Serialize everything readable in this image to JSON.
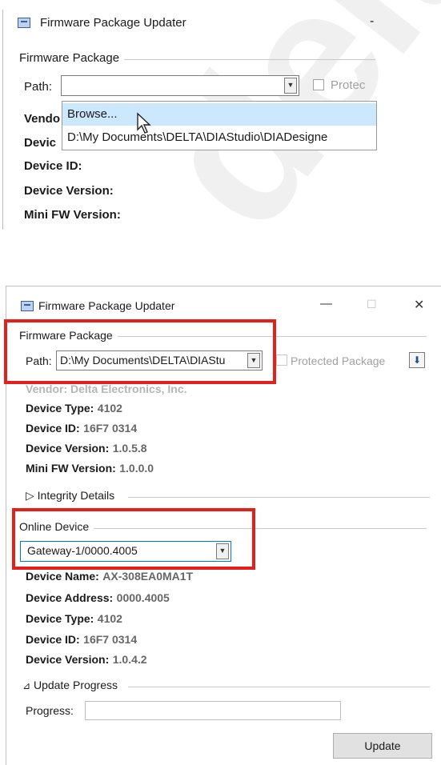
{
  "top_dialog": {
    "title": "Firmware Package Updater",
    "minimize_glyph": "-",
    "group_label": "Firmware Package",
    "path_label": "Path:",
    "path_value": "",
    "protected_label": "Protec",
    "dropdown_items": [
      "Browse...",
      "D:\\My Documents\\DELTA\\DIAStudio\\DIADesigne"
    ],
    "fields_partial": [
      "Vendo",
      "Devic"
    ],
    "fields": [
      "Device ID:",
      "Device Version:",
      "Mini FW Version:"
    ]
  },
  "bottom_dialog": {
    "title": "Firmware Package Updater",
    "window_controls": {
      "minimize": "—",
      "maximize": "☐",
      "close": "✕"
    },
    "firmware_group": {
      "label": "Firmware Package",
      "path_label": "Path:",
      "path_value": "D:\\My Documents\\DELTA\\DIAStu",
      "protected_label": "Protected Package",
      "download_glyph": "⬇"
    },
    "package_fields": [
      {
        "label": "Vendor:",
        "value": "Delta Electronics, Inc."
      },
      {
        "label": "Device Type:",
        "value": "4102"
      },
      {
        "label": "Device ID:",
        "value": "16F7 0314"
      },
      {
        "label": "Device Version:",
        "value": "1.0.5.8"
      },
      {
        "label": "Mini FW Version:",
        "value": "1.0.0.0"
      }
    ],
    "integrity": {
      "glyph": "▷",
      "label": "Integrity Details"
    },
    "online_group": {
      "label": "Online Device",
      "selected": "Gateway-1/0000.4005"
    },
    "device_fields": [
      {
        "label": "Device Name:",
        "value": "AX-308EA0MA1T"
      },
      {
        "label": "Device Address:",
        "value": "0000.4005"
      },
      {
        "label": "Device Type:",
        "value": "4102"
      },
      {
        "label": "Device ID:",
        "value": "16F7 0314"
      },
      {
        "label": "Device Version:",
        "value": "1.0.4.2"
      }
    ],
    "update_progress": {
      "glyph": "⊿",
      "label": "Update Progress",
      "progress_label": "Progress:"
    },
    "update_button": "Update"
  },
  "watermark": "delta",
  "colors": {
    "highlight_red": "#e1211a",
    "selection_blue": "#cce8ff",
    "accent_blue": "#0078d7"
  }
}
